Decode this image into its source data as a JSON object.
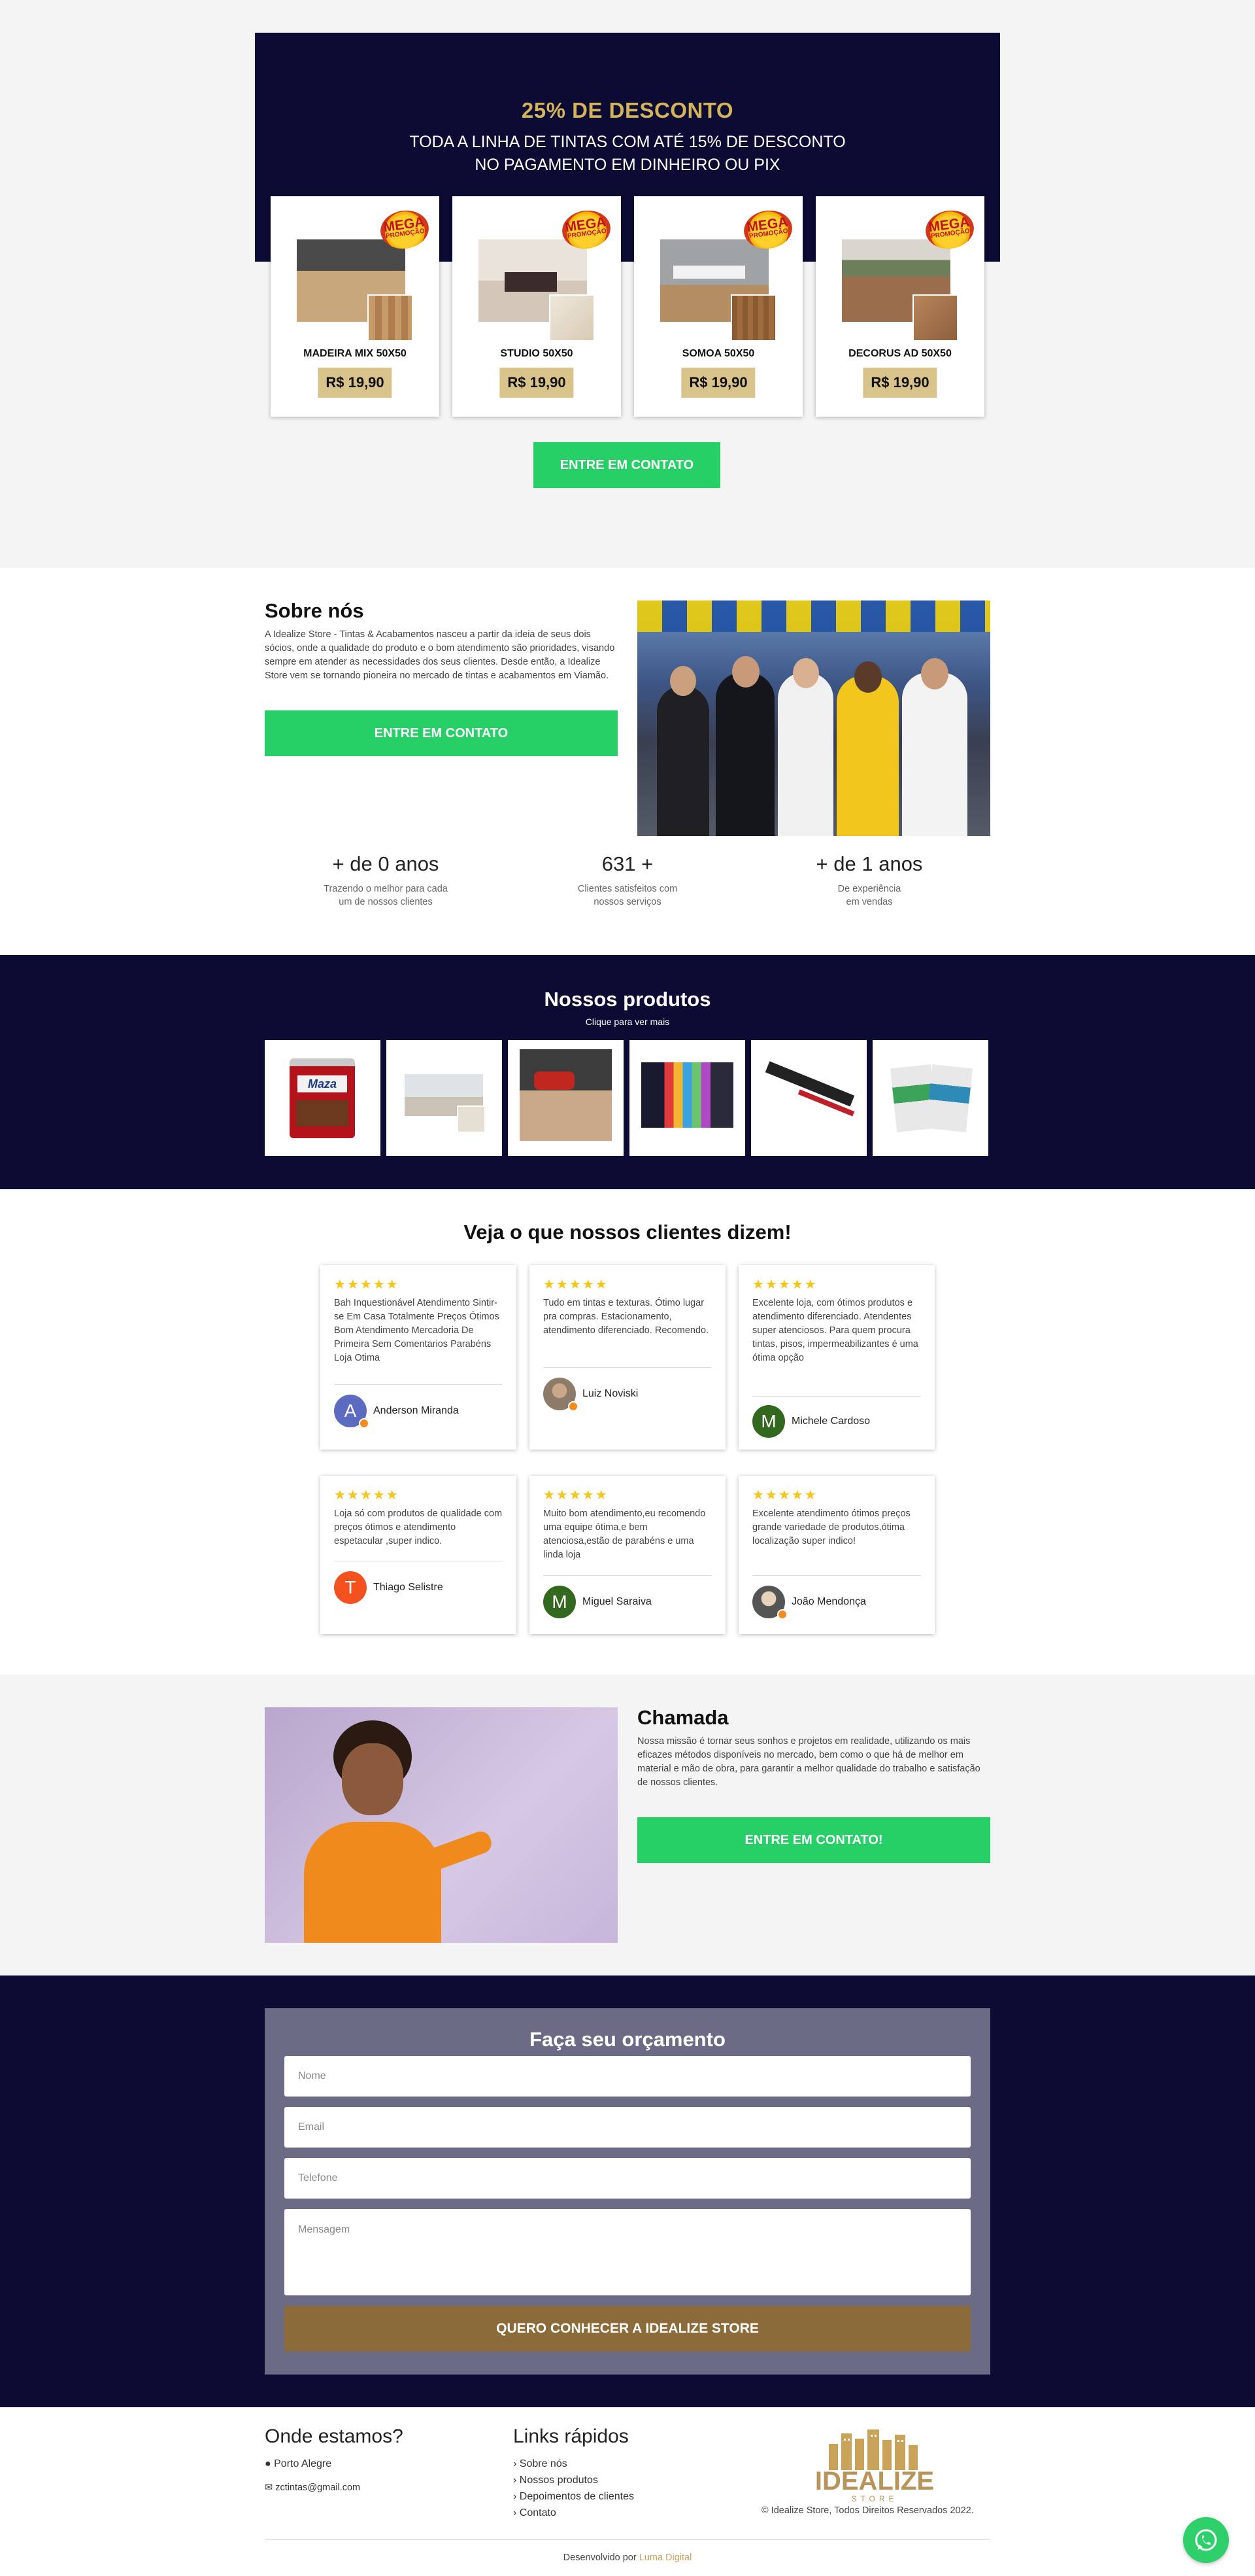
{
  "promo": {
    "title": "25% DE DESCONTO",
    "line1": "TODA A LINHA DE TINTAS COM ATÉ 15% DE DESCONTO",
    "line2": "NO PAGAMENTO EM DINHEIRO OU PIX",
    "badge_top": "MEGA",
    "badge_bottom": "PROMOÇÃO",
    "products": [
      {
        "name": "MADEIRA MIX 50X50",
        "price": "R$ 19,90"
      },
      {
        "name": "STUDIO 50X50",
        "price": "R$ 19,90"
      },
      {
        "name": "SOMOA 50X50",
        "price": "R$ 19,90"
      },
      {
        "name": "DECORUS AD 50X50",
        "price": "R$ 19,90"
      }
    ],
    "cta": "ENTRE EM CONTATO"
  },
  "about": {
    "title": "Sobre nós",
    "text": "A Idealize Store - Tintas & Acabamentos nasceu a partir da ideia de seus dois sócios, onde a qualidade do produto e o bom atendimento são prioridades, visando sempre em atender as necessidades dos seus clientes. Desde então, a Idealize Store vem se tornando pioneira no mercado de tintas e acabamentos em Viamão.",
    "cta": "ENTRE EM CONTATO",
    "stats": [
      {
        "number": "+ de 0 anos",
        "line1": "Trazendo o melhor para cada",
        "line2": "um de nossos clientes"
      },
      {
        "number": "631 +",
        "line1": "Clientes satisfeitos com",
        "line2": "nossos serviços"
      },
      {
        "number": "+ de 1 anos",
        "line1": "De experiência",
        "line2": "em vendas"
      }
    ]
  },
  "products": {
    "title": "Nossos produtos",
    "subtitle": "Clique para ver mais",
    "can_label": "Maza"
  },
  "testimonials": {
    "title": "Veja o que nossos clientes dizem!",
    "stars": "★★★★★",
    "items": [
      {
        "text": "Bah Inquestionável Atendimento Sintir-se Em Casa Totalmente Preços Ótimos Bom Atendimento Mercadoria De Primeira Sem Comentarios Parabéns Loja Otima",
        "name": "Anderson Miranda",
        "initial": "A",
        "color": "#5c6bc0"
      },
      {
        "text": "Tudo em tintas e texturas. Ótimo lugar pra compras. Estacionamento, atendimento diferenciado. Recomendo.",
        "name": "Luiz Noviski",
        "initial": "",
        "color": "#8d7b6a"
      },
      {
        "text": "Excelente loja, com ótimos produtos e atendimento diferenciado. Atendentes super atenciosos. Para quem procura tintas, pisos, impermeabilizantes é uma ótima opção",
        "name": "Michele Cardoso",
        "initial": "M",
        "color": "#33691e"
      },
      {
        "text": "Loja só com produtos de qualidade com preços ótimos e atendimento espetacular ,super indico.",
        "name": "Thiago Selistre",
        "initial": "T",
        "color": "#f4511e"
      },
      {
        "text": "Muito bom atendimento,eu recomendo uma equipe ótima,e bem atenciosa,estão de parabéns e uma linda loja",
        "name": "Miguel Saraiva",
        "initial": "M",
        "color": "#33691e"
      },
      {
        "text": "Excelente atendimento ótimos preços grande variedade de produtos,ótima localização super indico!",
        "name": "João Mendonça",
        "initial": "",
        "color": "#555555"
      }
    ]
  },
  "callout": {
    "title": "Chamada",
    "text": "Nossa missão é tornar seus sonhos e projetos em realidade, utilizando os mais eficazes métodos disponíveis no mercado, bem como o que há de melhor em material e mão de obra, para garantir a melhor qualidade do trabalho e satisfação de nossos clientes.",
    "cta": "ENTRE EM CONTATO!"
  },
  "quote": {
    "title": "Faça seu orçamento",
    "name_placeholder": "Nome",
    "email_placeholder": "Email",
    "phone_placeholder": "Telefone",
    "message_placeholder": "Mensagem",
    "submit": "QUERO CONHECER A IDEALIZE STORE"
  },
  "footer": {
    "where_title": "Onde estamos?",
    "city": "Porto Alegre",
    "email": "zctintas@gmail.com",
    "links_title": "Links rápidos",
    "links": [
      "Sobre nós",
      "Nossos produtos",
      "Depoimentos de clientes",
      "Contato"
    ],
    "logo_main": "IDEALIZE",
    "logo_sub": "STORE",
    "copyright": "© Idealize Store, Todos Direitos Reservados 2022.",
    "dev_prefix": "Desenvolvido por",
    "dev_name": "Luma Digital"
  },
  "colors": {
    "navy": "#0b0b33",
    "green": "#27cf67",
    "gold": "#d4b35a",
    "bronze": "#8c6b3a"
  }
}
